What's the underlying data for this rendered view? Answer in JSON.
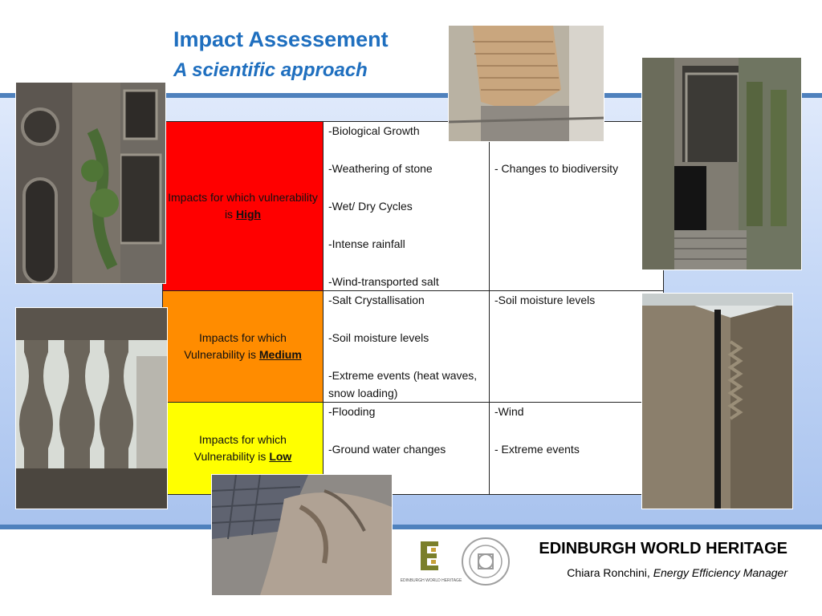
{
  "slide": {
    "title": "Impact Assessement",
    "subtitle": "A scientific approach"
  },
  "table": {
    "rows": [
      {
        "level_prefix": "Impacts for which vulnerability is",
        "level": "High",
        "color": "#ff0000",
        "col1": [
          "-Biological Growth",
          "-Weathering of stone",
          "-Wet/ Dry Cycles",
          "-Intense rainfall",
          "-Wind-transported salt"
        ],
        "col2": [
          "- Changes to biodiversity"
        ]
      },
      {
        "level_prefix": "Impacts for which Vulnerability is",
        "level": "Medium",
        "color": "#ff8c00",
        "col1": [
          "-Salt Crystallisation",
          "-Soil moisture levels",
          "-Extreme events (heat waves, snow loading)"
        ],
        "col2": [
          "-Soil moisture levels"
        ]
      },
      {
        "level_prefix": "Impacts for which Vulnerability is",
        "level": "Low",
        "color": "#ffff00",
        "col1": [
          "-Flooding",
          "-Ground water changes"
        ],
        "col2": [
          "-Wind",
          "- Extreme events"
        ]
      }
    ]
  },
  "footer": {
    "organisation": "EDINBURGH WORLD HERITAGE",
    "person": "Chiara Ronchini,",
    "role": "Energy Efficiency Manager",
    "logo_text": "EDINBURGH WORLD HERITAGE"
  },
  "colors": {
    "accent": "#1f6fbf",
    "band_line": "#4f81bd"
  }
}
